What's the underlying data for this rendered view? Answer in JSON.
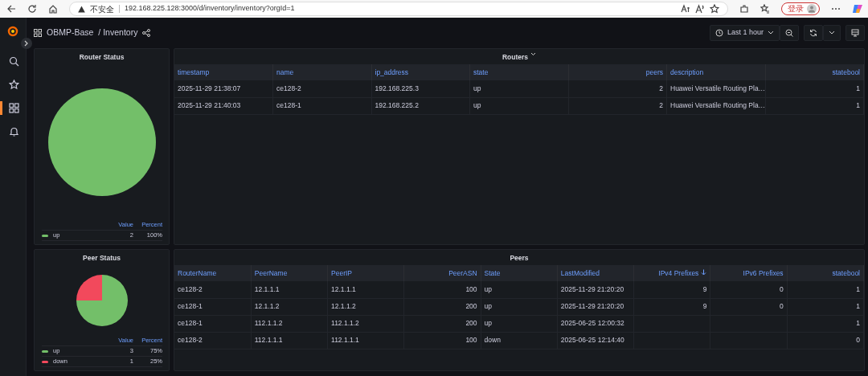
{
  "browser": {
    "security_label": "不安全",
    "url": "192.168.225.128:3000/d/inventory/inventory?orgId=1",
    "login_button": "登录"
  },
  "sidebar": {
    "items": [
      {
        "kind": "search",
        "selected": false
      },
      {
        "kind": "starred",
        "selected": false
      },
      {
        "kind": "dashboards",
        "selected": true
      },
      {
        "kind": "alerts",
        "selected": false
      }
    ]
  },
  "header": {
    "folder": "OBMP-Base",
    "dashboard": "/ Inventory",
    "time_range": "Last 1 hour"
  },
  "panels": [
    {
      "kind": "pie",
      "title": "Router Status",
      "legend": {
        "percent_header": "Percent",
        "items": [
          {
            "value": "2",
            "percent": "100%",
            "color": "#73bf69"
          }
        ]
      },
      "chart_data": {
        "type": "pie",
        "categories": [
          "up"
        ],
        "series": [
          {
            "name": "Value",
            "values": [
              100
            ]
          }
        ]
      }
    },
    {
      "kind": "table",
      "title": "Routers",
      "menu_caret": true,
      "table": {
        "columns": [
          {
            "label": "timestamp",
            "kind": "text",
            "sorted": false
          },
          {
            "label": "name",
            "kind": "text",
            "sorted": false
          },
          {
            "label": "ip_address",
            "kind": "text",
            "sorted": false
          },
          {
            "label": "state",
            "kind": "text",
            "sorted": false
          },
          {
            "label": "peers",
            "kind": "number",
            "sorted": false
          },
          {
            "label": "description",
            "kind": "text",
            "sorted": false
          },
          {
            "label": "statebool",
            "kind": "number",
            "sorted": false
          }
        ],
        "rows": [
          [
            "2025-11-29 21:38:07",
            "ce128-2",
            "192.168.225.3",
            "up",
            "2",
            "Huawei Versatile Routing Pla…",
            "1"
          ],
          [
            "2025-11-29 21:40:03",
            "ce128-1",
            "192.168.225.2",
            "up",
            "2",
            "Huawei Versatile Routing Pla…",
            "1"
          ]
        ]
      }
    },
    {
      "kind": "pie",
      "title": "Peer Status",
      "legend": {
        "percent_header": "Percent",
        "items": [
          {
            "value": "3",
            "percent": "75%",
            "color": "#73bf69"
          },
          {
            "value": "1",
            "percent": "25%",
            "color": "#f2495c"
          }
        ]
      },
      "chart_data": {
        "type": "pie",
        "categories": [
          "up",
          "down"
        ],
        "series": [
          {
            "name": "Value",
            "values": [
              75,
              25
            ]
          }
        ]
      }
    },
    {
      "kind": "table",
      "title": "Peers",
      "menu_caret": false,
      "table": {
        "columns": [
          {
            "label": "RouterName",
            "kind": "text",
            "sorted": false
          },
          {
            "label": "PeerName",
            "kind": "text",
            "sorted": false
          },
          {
            "label": "PeerIP",
            "kind": "text",
            "sorted": false
          },
          {
            "label": "PeerASN",
            "kind": "number",
            "sorted": false
          },
          {
            "label": "State",
            "kind": "text",
            "sorted": false
          },
          {
            "label": "LastModified",
            "kind": "text",
            "sorted": false
          },
          {
            "label": "IPv4 Prefixes",
            "kind": "number",
            "sorted": true
          },
          {
            "label": "IPv6 Prefixes",
            "kind": "number",
            "sorted": false
          },
          {
            "label": "statebool",
            "kind": "number",
            "sorted": false
          }
        ],
        "rows": [
          [
            "ce128-2",
            "12.1.1.1",
            "12.1.1.1",
            "100",
            "up",
            "2025-11-29 21:20:20",
            "9",
            "0",
            "1"
          ],
          [
            "ce128-1",
            "12.1.1.2",
            "12.1.1.2",
            "200",
            "up",
            "2025-11-29 21:20:20",
            "9",
            "0",
            "1"
          ],
          [
            "ce128-1",
            "112.1.1.2",
            "112.1.1.2",
            "200",
            "up",
            "2025-06-25 12:00:32",
            "",
            "",
            "1"
          ],
          [
            "ce128-2",
            "112.1.1.1",
            "112.1.1.1",
            "100",
            "down",
            "2025-06-25 12:14:40",
            "",
            "",
            "0"
          ]
        ]
      }
    }
  ]
}
